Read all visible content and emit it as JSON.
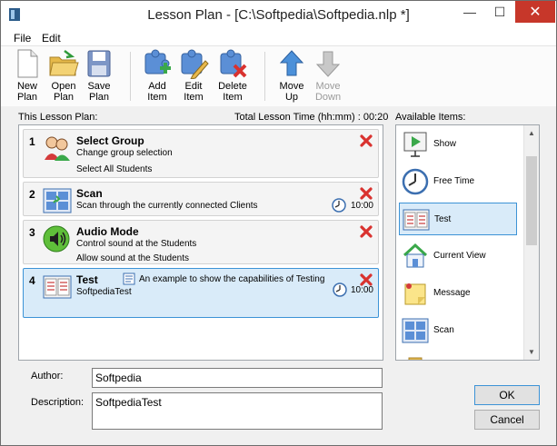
{
  "window": {
    "title": "Lesson Plan - [C:\\Softpedia\\Softpedia.nlp *]",
    "min_label": "—",
    "max_label": "☐",
    "close_label": "✕"
  },
  "menu": [
    "File",
    "Edit"
  ],
  "toolbar": {
    "new_plan": "New\nPlan",
    "open_plan": "Open\nPlan",
    "save_plan": "Save\nPlan",
    "add_item": "Add\nItem",
    "edit_item": "Edit\nItem",
    "delete_item": "Delete\nItem",
    "move_up": "Move\nUp",
    "move_down": "Move\nDown"
  },
  "lesson_plan": {
    "label": "This Lesson Plan:",
    "total_time_label": "Total Lesson Time (hh:mm) : 00:20",
    "items": [
      {
        "num": "1",
        "title": "Select Group",
        "line1": "Change group selection",
        "line2": "Select All Students",
        "time": "",
        "icon": "select-group-icon"
      },
      {
        "num": "2",
        "title": "Scan",
        "line1": "Scan through the currently connected Clients",
        "line2": "",
        "time": "10:00",
        "icon": "scan-icon"
      },
      {
        "num": "3",
        "title": "Audio Mode",
        "line1": "Control sound at the Students",
        "line2": "Allow sound at the Students",
        "time": "",
        "icon": "speaker-icon"
      },
      {
        "num": "4",
        "title": "Test",
        "line1": "SoftpediaTest",
        "line2": "",
        "note": "An example to show the capabilities of Testing",
        "time": "10:00",
        "icon": "test-icon"
      }
    ]
  },
  "available": {
    "label": "Available Items:",
    "items": [
      {
        "label": "Show",
        "icon": "show-icon"
      },
      {
        "label": "Free Time",
        "icon": "clock-icon"
      },
      {
        "label": "Test",
        "icon": "test-icon"
      },
      {
        "label": "Current View",
        "icon": "house-icon"
      },
      {
        "label": "Message",
        "icon": "note-icon"
      },
      {
        "label": "Scan",
        "icon": "scan-icon"
      }
    ],
    "scroll_up": "▲",
    "scroll_down": "▼"
  },
  "form": {
    "author_label": "Author:",
    "author_value": "Softpedia",
    "description_label": "Description:",
    "description_value": "SoftpediaTest"
  },
  "buttons": {
    "ok": "OK",
    "cancel": "Cancel"
  },
  "colors": {
    "selection": "#d9ebf9",
    "selection_border": "#3c93d6",
    "delete_red": "#d9322f"
  }
}
